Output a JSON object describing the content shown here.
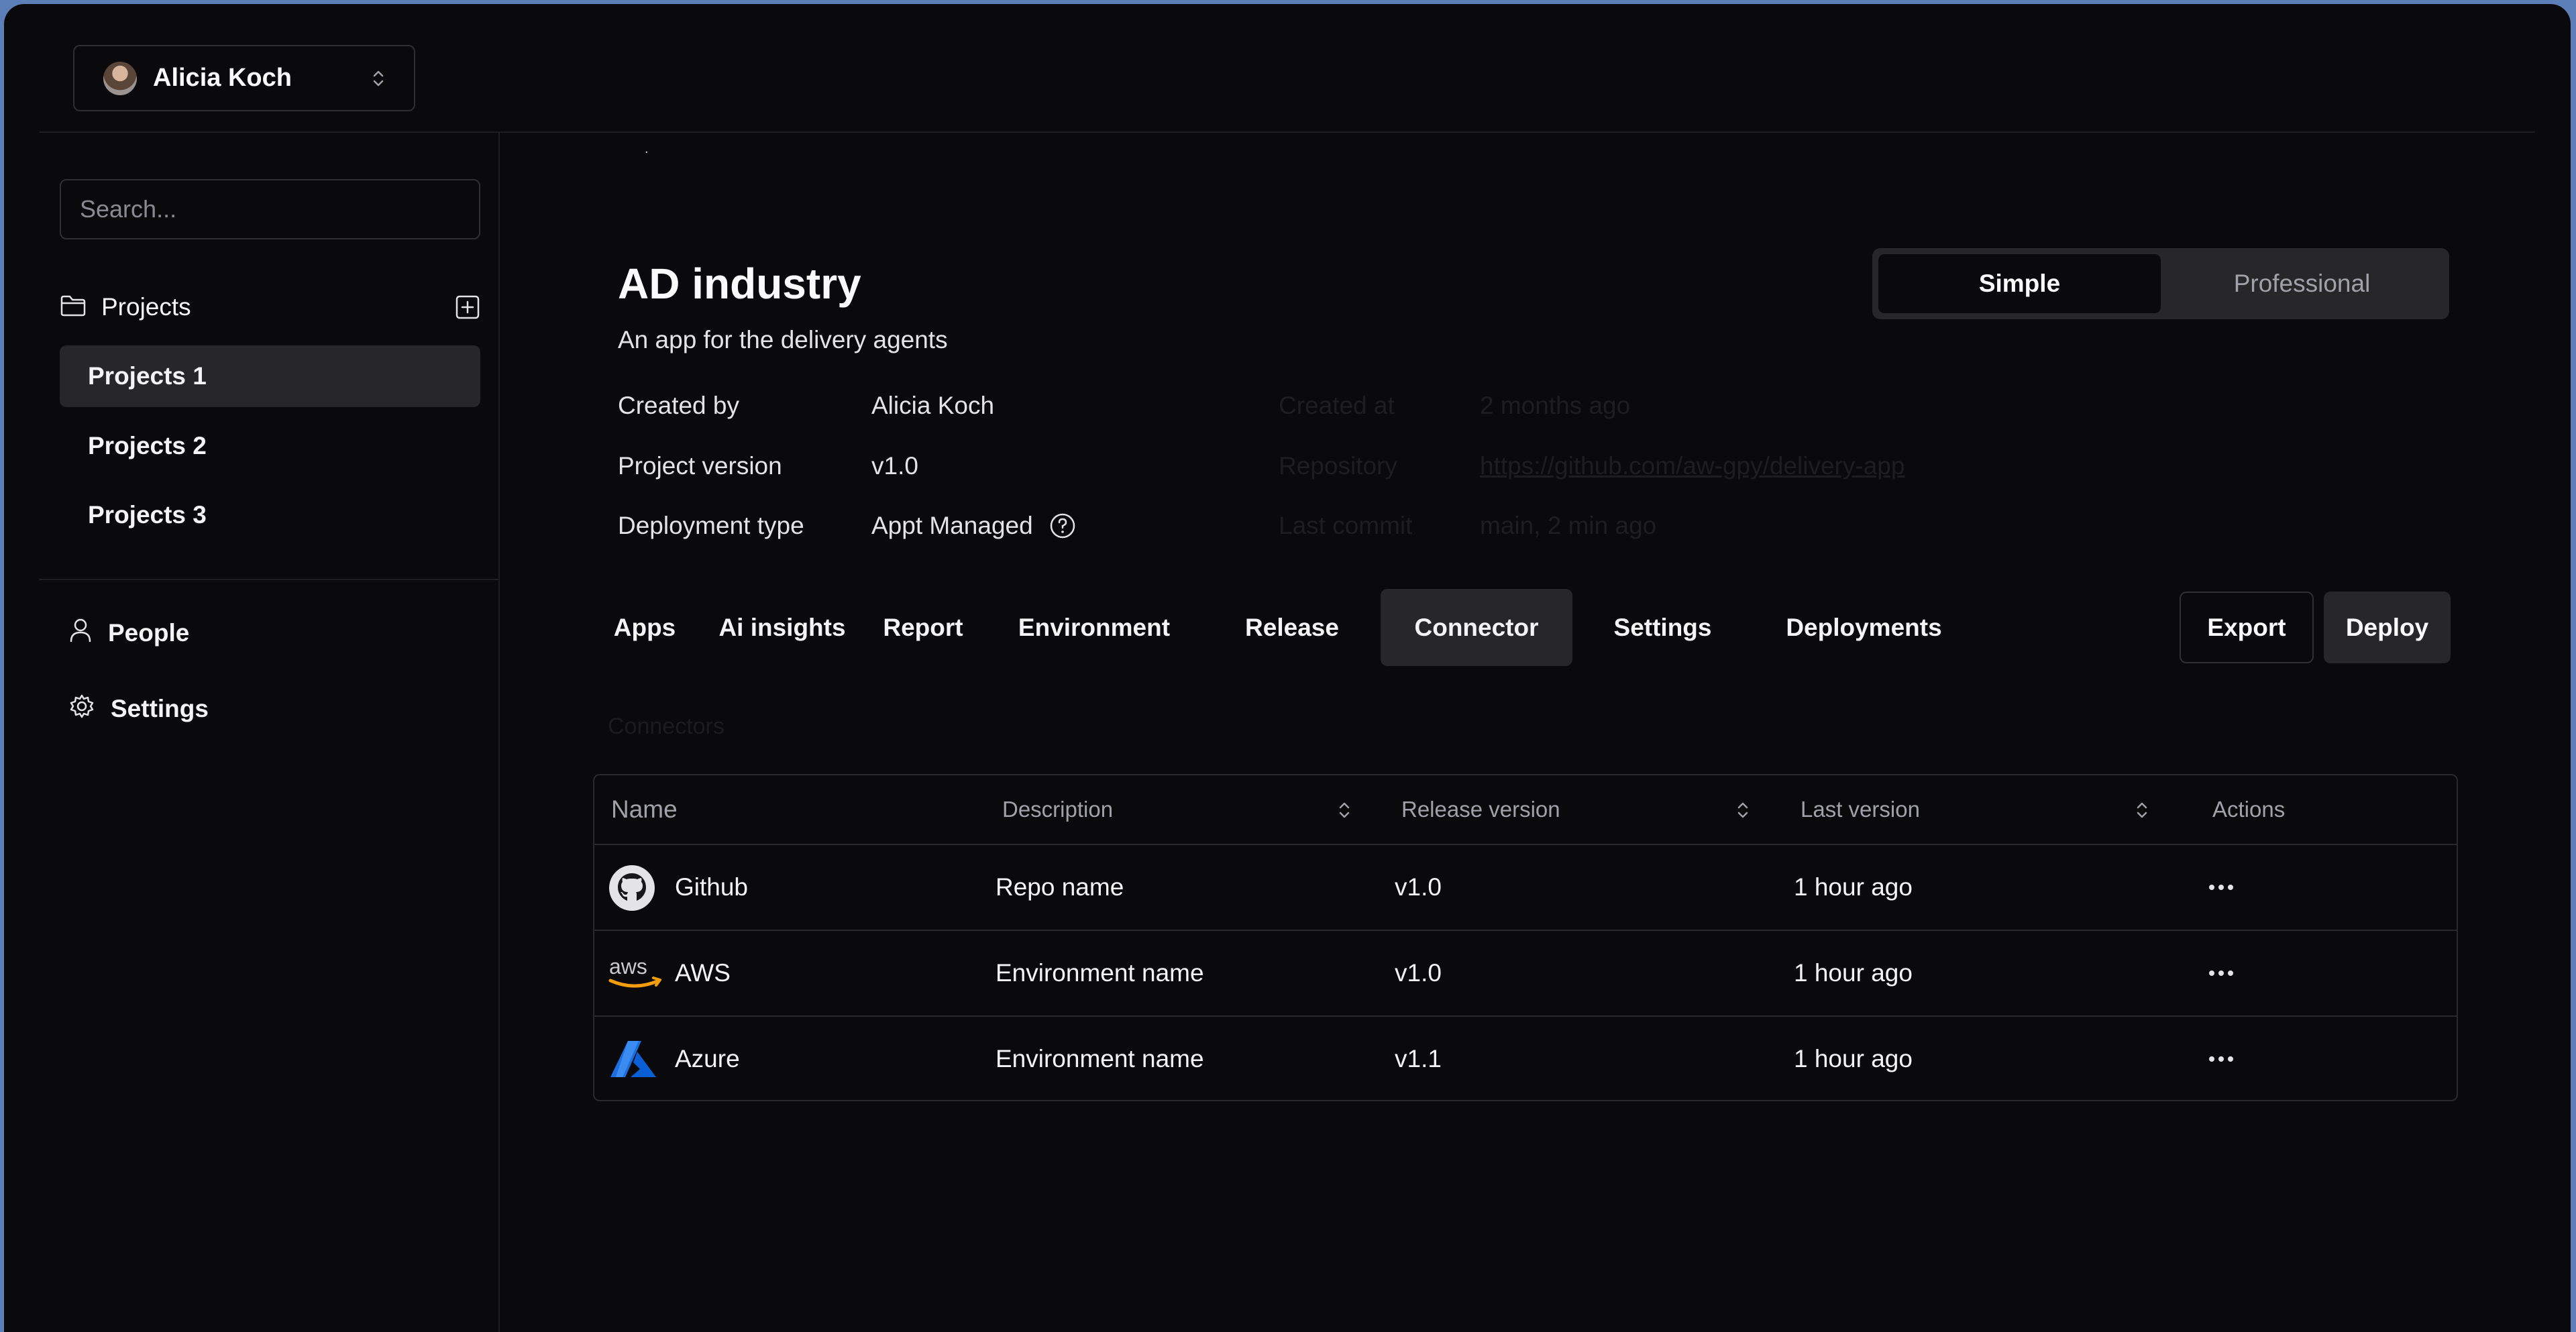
{
  "account": {
    "name": "Alicia Koch"
  },
  "sidebar": {
    "search_placeholder": "Search...",
    "projects_label": "Projects",
    "projects": [
      "Projects 1",
      "Projects 2",
      "Projects 3"
    ],
    "active_project": "Projects 1",
    "nav": [
      {
        "label": "People",
        "icon": "user-icon"
      },
      {
        "label": "Settings",
        "icon": "gear-icon"
      }
    ]
  },
  "main": {
    "title": "AD industry",
    "subtitle": "An app for the delivery agents",
    "meta": {
      "created_by_label": "Created by",
      "created_by": "Alicia Koch",
      "version_label": "Project version",
      "version": "v1.0",
      "deployment_label": "Deployment type",
      "deployment": "Appt Managed",
      "created_at_label": "Created at",
      "created_at": "2 months ago",
      "repository_label": "Repository",
      "repository": "https://github.com/aw-gpy/delivery-app",
      "last_commit_label": "Last commit",
      "last_commit": "main, 2 min ago"
    },
    "mode": {
      "options": [
        "Simple",
        "Professional"
      ],
      "selected": "Simple"
    },
    "tabs": [
      "Apps",
      "Ai insights",
      "Report",
      "Environment",
      "Release",
      "Connector",
      "Settings",
      "Deployments"
    ],
    "active_tab": "Connector",
    "actions": {
      "export": "Export",
      "deploy": "Deploy"
    },
    "section_title": "Connectors",
    "table": {
      "headers": {
        "name": "Name",
        "description": "Description",
        "release": "Release version",
        "last": "Last version",
        "actions": "Actions"
      },
      "rows": [
        {
          "name": "Github",
          "logo": "github-logo",
          "description": "Repo name",
          "release": "v1.0",
          "last": "1 hour ago"
        },
        {
          "name": "AWS",
          "logo": "aws-logo",
          "description": "Environment name",
          "release": "v1.0",
          "last": "1 hour ago"
        },
        {
          "name": "Azure",
          "logo": "azure-logo",
          "description": "Environment name",
          "release": "v1.1",
          "last": "1 hour ago"
        }
      ]
    }
  },
  "colors": {
    "background": "#0a0a0c",
    "surface": "#27272a",
    "border": "#2a2a2e",
    "azure": "#0a5fd6",
    "aws_smile": "#f59e0b"
  }
}
